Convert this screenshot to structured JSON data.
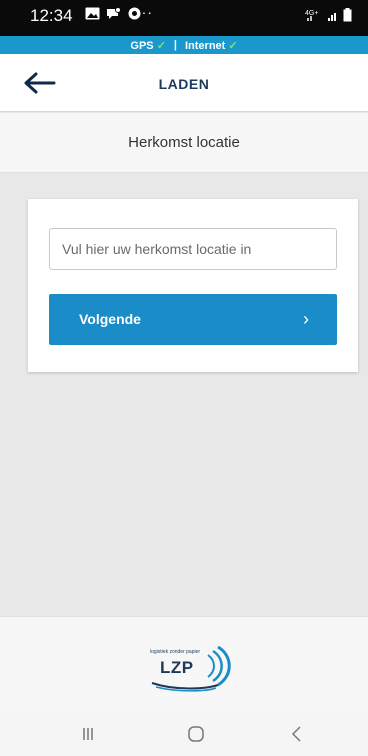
{
  "status_bar": {
    "time": "12:34",
    "more": "···",
    "network": "4G+",
    "notification_icons": [
      "gallery-icon",
      "message-icon",
      "chrome-icon"
    ]
  },
  "connection_bar": {
    "gps_label": "GPS",
    "separator": "|",
    "internet_label": "Internet",
    "check": "✓",
    "status_color": "#7be07b"
  },
  "header": {
    "title": "LADEN",
    "back_icon": "arrow-left-icon"
  },
  "subheader": {
    "title": "Herkomst locatie"
  },
  "form": {
    "origin_input": {
      "placeholder": "Vul hier uw herkomst locatie in",
      "value": ""
    },
    "next_button": {
      "label": "Volgende",
      "chevron": "›"
    }
  },
  "footer": {
    "logo_tagline": "logistiek zonder papier",
    "logo_text": "LZP"
  },
  "nav_bar": {
    "icons": [
      "recent-apps-icon",
      "home-icon",
      "back-icon"
    ]
  },
  "colors": {
    "accent": "#1a8dc8",
    "connection_bar": "#1a98cc",
    "header_text": "#1d3a5c",
    "background": "#e8e8e8"
  }
}
